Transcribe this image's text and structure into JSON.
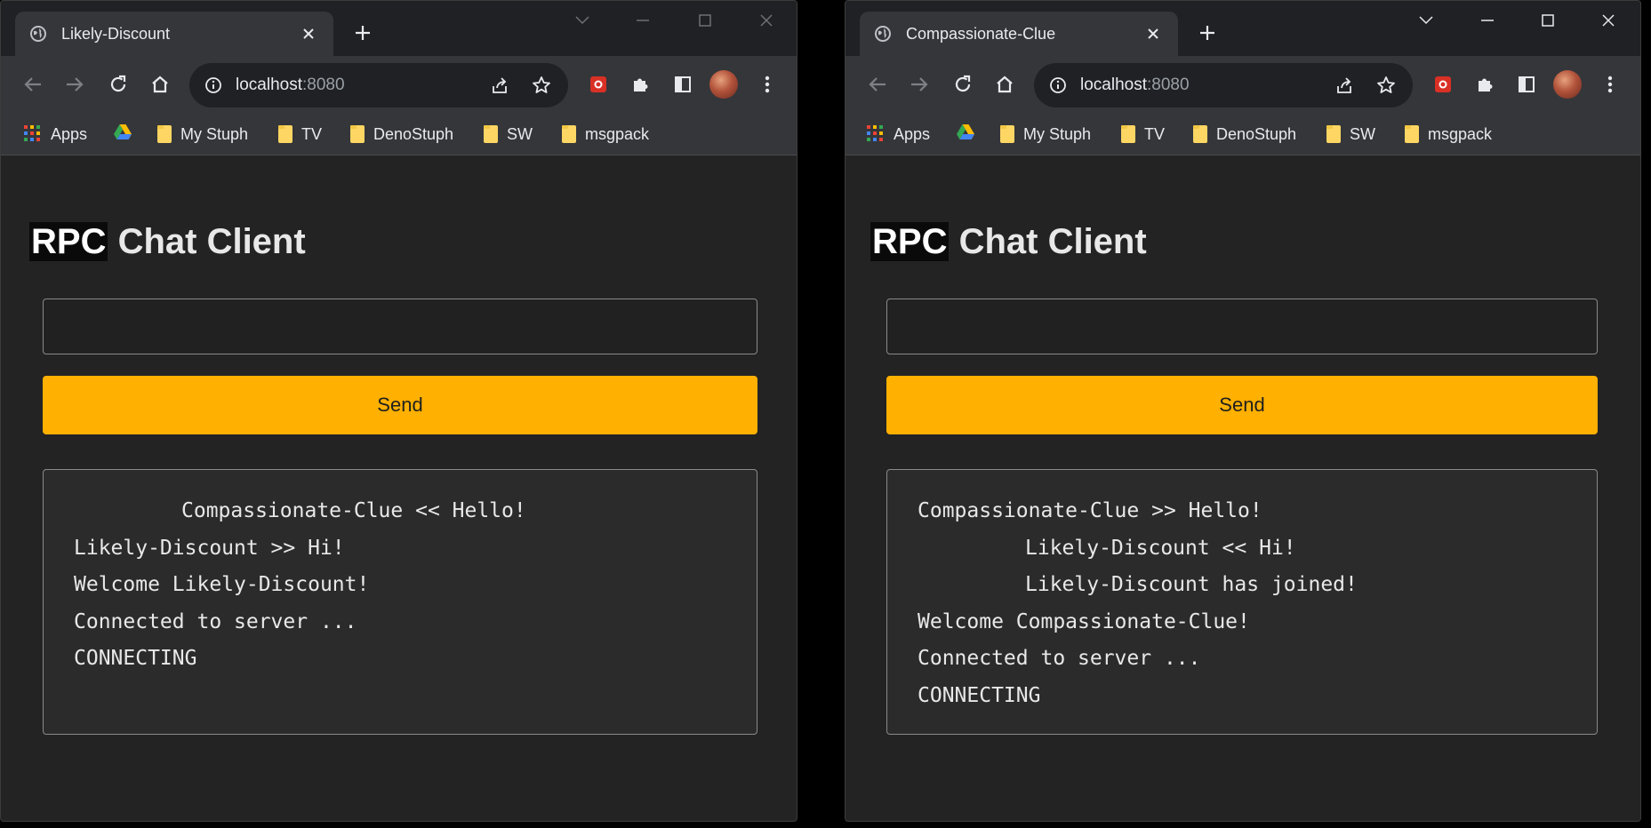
{
  "windows": [
    {
      "tab_title": "Likely-Discount",
      "url_host": "localhost",
      "url_port": ":8080",
      "bookmarks": [
        "Apps",
        "My Stuph",
        "TV",
        "DenoStuph",
        "SW",
        "msgpack"
      ],
      "heading_highlight": "RPC",
      "heading_rest": " Chat Client",
      "input_value": "",
      "send_label": "Send",
      "log": [
        {
          "text": "Compassionate-Clue << Hello!",
          "indent": true
        },
        {
          "text": "Likely-Discount >> Hi!",
          "indent": false
        },
        {
          "text": "Welcome Likely-Discount!",
          "indent": false
        },
        {
          "text": "Connected to server ...",
          "indent": false
        },
        {
          "text": "CONNECTING",
          "indent": false
        }
      ]
    },
    {
      "tab_title": "Compassionate-Clue",
      "url_host": "localhost",
      "url_port": ":8080",
      "bookmarks": [
        "Apps",
        "My Stuph",
        "TV",
        "DenoStuph",
        "SW",
        "msgpack"
      ],
      "heading_highlight": "RPC",
      "heading_rest": " Chat Client",
      "input_value": "",
      "send_label": "Send",
      "log": [
        {
          "text": "Compassionate-Clue >> Hello!",
          "indent": false
        },
        {
          "text": "Likely-Discount << Hi!",
          "indent": true
        },
        {
          "text": "Likely-Discount has joined!",
          "indent": true
        },
        {
          "text": "Welcome Compassionate-Clue!",
          "indent": false
        },
        {
          "text": "Connected to server ...",
          "indent": false
        },
        {
          "text": "CONNECTING",
          "indent": false
        }
      ]
    }
  ],
  "icons": {
    "favicon": "globe-icon",
    "close": "close-icon",
    "new_tab": "plus-icon",
    "back": "back-arrow-icon",
    "forward": "forward-arrow-icon",
    "reload": "reload-icon",
    "home": "home-icon",
    "info": "info-icon",
    "share": "share-icon",
    "bookmark_star": "star-icon",
    "extension_red": "record-extension-icon",
    "extensions": "puzzle-icon",
    "side_panel": "side-panel-icon",
    "menu": "kebab-menu-icon"
  },
  "colors": {
    "accent": "#ffb000",
    "page_bg": "#232323",
    "chrome_dark": "#202124",
    "chrome_light": "#35363a",
    "folder": "#fdd663"
  }
}
